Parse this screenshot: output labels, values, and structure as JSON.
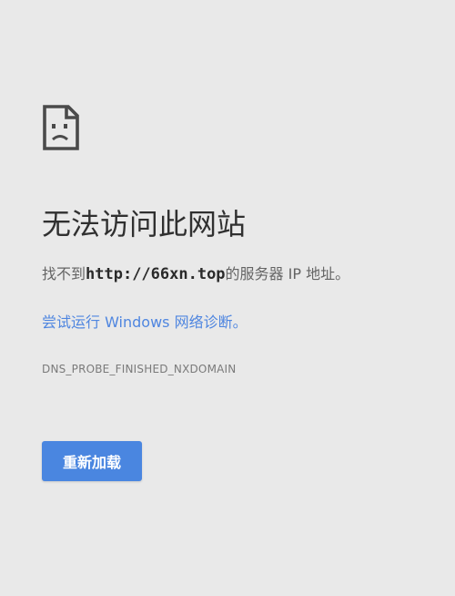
{
  "error_page": {
    "icon": "sad-page-icon",
    "title": "无法访问此网站",
    "message_prefix": "找不到",
    "host": "http://66xn.top",
    "message_suffix": "的服务器 IP 地址。",
    "diagnose_link": "尝试运行 Windows 网络诊断。",
    "error_code": "DNS_PROBE_FINISHED_NXDOMAIN",
    "reload_label": "重新加载"
  },
  "colors": {
    "background": "#e9e9e9",
    "title": "#303030",
    "link": "#4f86e0",
    "button": "#4a86e0"
  }
}
